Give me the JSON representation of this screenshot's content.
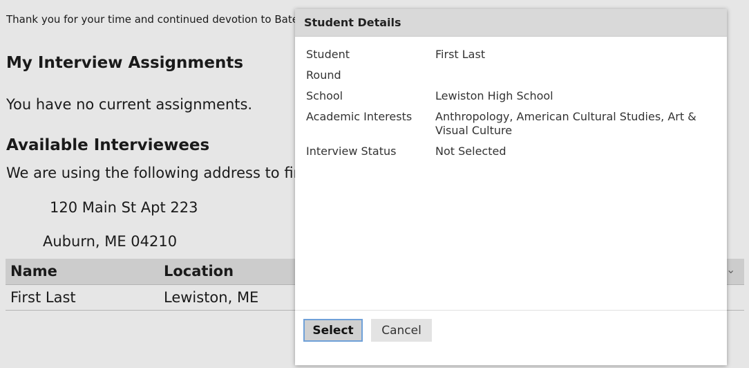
{
  "page": {
    "thanks_text": "Thank you for your time and continued devotion to Bates",
    "assignments_heading": "My Interview Assignments",
    "no_assignments": "You have no current assignments.",
    "available_heading": "Available Interviewees",
    "address_intro": "We are using the following address to fir",
    "address_line1": "120 Main St Apt 223",
    "address_line2": "Auburn, ME 04210",
    "table": {
      "columns": [
        "Name",
        "Location"
      ],
      "rows": [
        {
          "name": "First Last",
          "location": "Lewiston, ME"
        }
      ],
      "sort_icon": "chevron-down-icon"
    }
  },
  "dialog": {
    "title": "Student Details",
    "fields": [
      {
        "label": "Student",
        "value": "First Last"
      },
      {
        "label": "Round",
        "value": ""
      },
      {
        "label": "School",
        "value": "Lewiston High School"
      },
      {
        "label": "Academic Interests",
        "value": "Anthropology, American Cultural Studies, Art & Visual Culture"
      },
      {
        "label": "Interview Status",
        "value": "Not Selected"
      }
    ],
    "select_label": "Select",
    "cancel_label": "Cancel"
  }
}
